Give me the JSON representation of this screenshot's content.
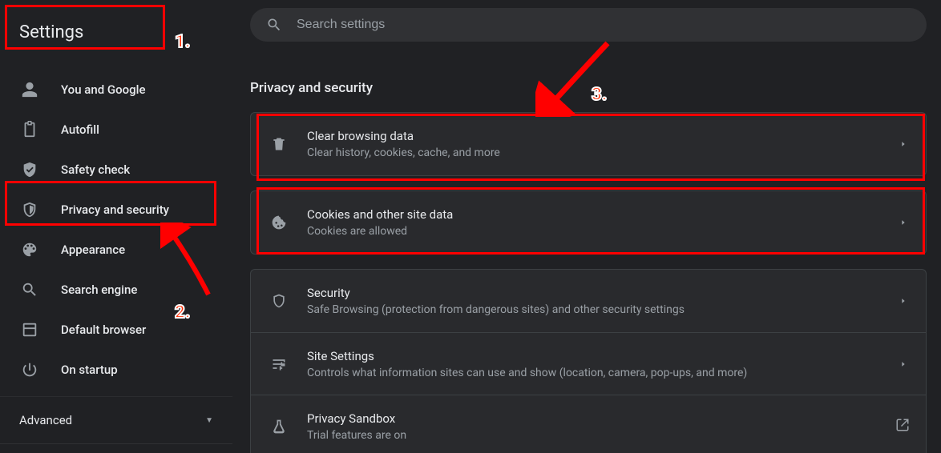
{
  "sidebar": {
    "title": "Settings",
    "items": [
      {
        "label": "You and Google"
      },
      {
        "label": "Autofill"
      },
      {
        "label": "Safety check"
      },
      {
        "label": "Privacy and security"
      },
      {
        "label": "Appearance"
      },
      {
        "label": "Search engine"
      },
      {
        "label": "Default browser"
      },
      {
        "label": "On startup"
      }
    ],
    "advanced_label": "Advanced"
  },
  "search": {
    "placeholder": "Search settings"
  },
  "section_title": "Privacy and security",
  "rows": [
    {
      "title": "Clear browsing data",
      "sub": "Clear history, cookies, cache, and more"
    },
    {
      "title": "Cookies and other site data",
      "sub": "Cookies are allowed"
    },
    {
      "title": "Security",
      "sub": "Safe Browsing (protection from dangerous sites) and other security settings"
    },
    {
      "title": "Site Settings",
      "sub": "Controls what information sites can use and show (location, camera, pop-ups, and more)"
    },
    {
      "title": "Privacy Sandbox",
      "sub": "Trial features are on"
    }
  ],
  "annotations": {
    "n1": "1.",
    "n2": "2.",
    "n3": "3."
  }
}
